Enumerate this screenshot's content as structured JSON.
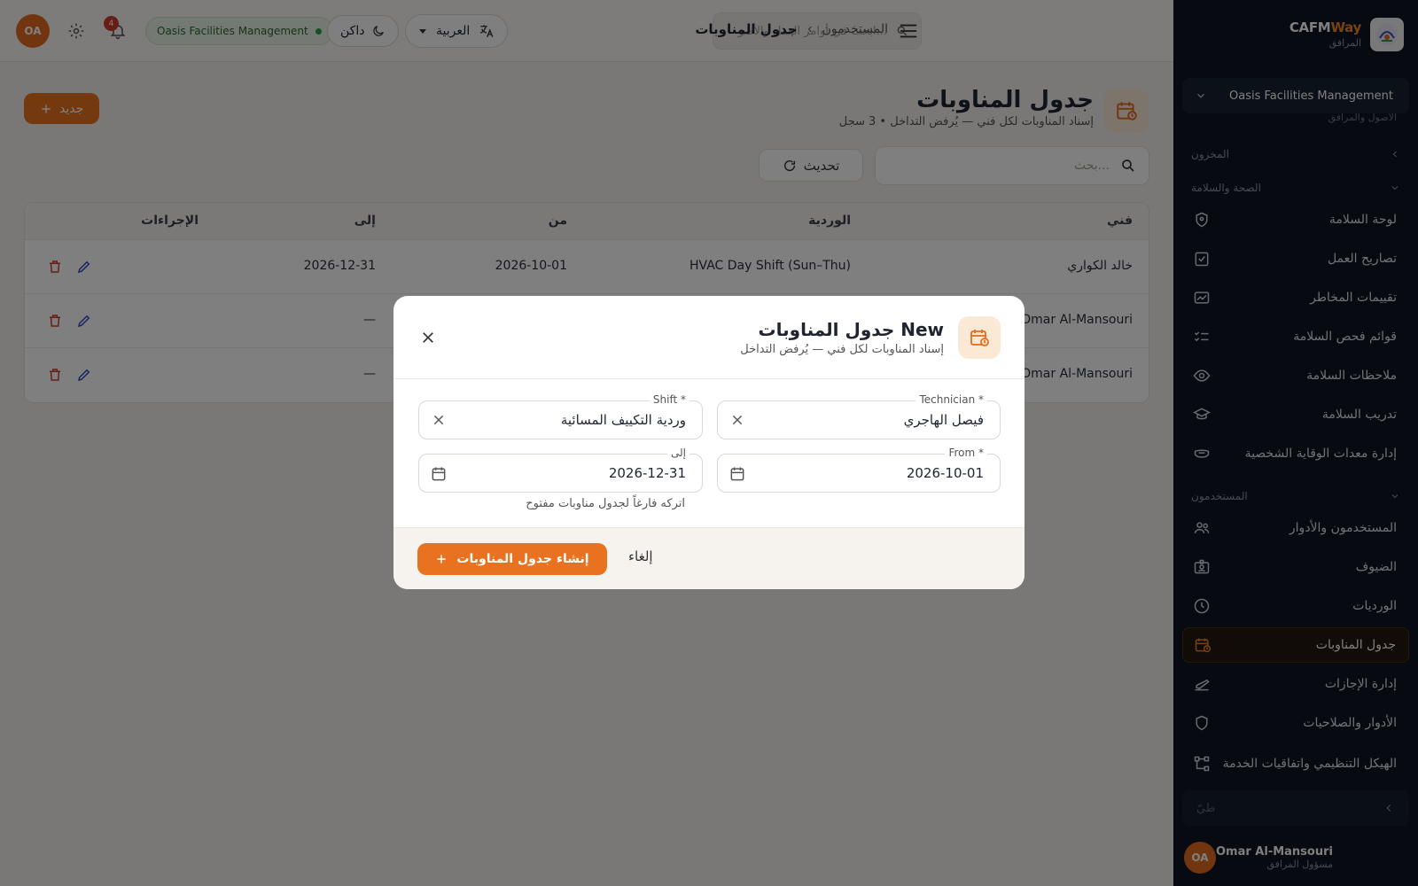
{
  "app": {
    "brand_primary": "CAFM",
    "brand_accent": "Way",
    "brand_sub": "المرافق"
  },
  "sidebar": {
    "org": "Oasis Facilities Management",
    "cut_section": "الأصول والمرافق",
    "sections": [
      {
        "label": "المخزون"
      },
      {
        "label": "الصحة والسلامة"
      },
      {
        "label": "المستخدمون"
      }
    ],
    "items": [
      {
        "label": "لوحة السلامة",
        "icon": "shield-icon"
      },
      {
        "label": "تصاريح العمل",
        "icon": "clipboard-check-icon"
      },
      {
        "label": "تقييمات المخاطر",
        "icon": "chart-icon"
      },
      {
        "label": "قوائم فحص السلامة",
        "icon": "checklist-icon"
      },
      {
        "label": "ملاحظات السلامة",
        "icon": "eye-icon"
      },
      {
        "label": "تدريب السلامة",
        "icon": "graduation-cap-icon"
      },
      {
        "label": "إدارة معدات الوقاية الشخصية",
        "icon": "mask-icon"
      },
      {
        "label": "المستخدمون والأدوار",
        "icon": "users-icon"
      },
      {
        "label": "الضيوف",
        "icon": "badge-icon"
      },
      {
        "label": "الورديات",
        "icon": "clock-icon"
      },
      {
        "label": "جدول المناوبات",
        "icon": "calendar-clock-icon",
        "active": true
      },
      {
        "label": "إدارة الإجازات",
        "icon": "plane-icon"
      },
      {
        "label": "الأدوار والصلاحيات",
        "icon": "shield-outline-icon"
      },
      {
        "label": "الهيكل التنظيمي واتفاقيات الخدمة",
        "icon": "org-chart-icon"
      }
    ],
    "collapse_label": "طيّ",
    "user": {
      "initials": "OA",
      "name": "Omar Al-Mansouri",
      "role": "مسؤول المرافق"
    }
  },
  "topbar": {
    "avatar_initials": "OA",
    "notification_count": "4",
    "org_badge": "Oasis Facilities Management",
    "theme_label": "داكن",
    "language_label": "العربية",
    "search_placeholder": "ابحث في أوامر العمل والأصو...",
    "breadcrumb_parent": "المستخدمون",
    "breadcrumb_current": "جدول المناوبات"
  },
  "page": {
    "title": "جدول المناوبات",
    "subtitle": "إسناد المناوبات لكل فني — يُرفض التداخل",
    "record_count": "3 سجل",
    "new_button": "جديد",
    "search_placeholder": "بحث...",
    "refresh_label": "تحديث"
  },
  "table": {
    "headers": {
      "technician": "فني",
      "shift": "الوردية",
      "from": "من",
      "to": "إلى",
      "actions": "الإجراءات"
    },
    "rows": [
      {
        "technician": "خالد الكواري",
        "shift": "HVAC Day Shift (Sun–Thu)",
        "from": "2026-10-01",
        "to": "2026-12-31"
      },
      {
        "technician": "Omar Al-Mansouri",
        "shift": "",
        "from": "",
        "to": "—"
      },
      {
        "technician": "Omar Al-Mansouri",
        "shift": "",
        "from": "",
        "to": "—"
      }
    ]
  },
  "modal": {
    "title": "New جدول المناوبات",
    "subtitle": "إسناد المناوبات لكل فني — يُرفض التداخل",
    "technician_label": "Technician *",
    "technician_value": "فيصل الهاجري",
    "shift_label": "Shift *",
    "shift_value": "وردية التكييف المسائية",
    "from_label": "From *",
    "from_value": "2026-10-01",
    "to_label": "إلى",
    "to_value": "2026-12-31",
    "to_helper": "اتركه فارغاً لجدول مناوبات مفتوح",
    "create_button": "إنشاء جدول المناوبات",
    "cancel_button": "إلغاء"
  },
  "colors": {
    "accent": "#e8721f",
    "sidebar_bg": "#0f1521",
    "danger": "#d23a2f",
    "edit": "#2f47c8",
    "status_ok": "#2e9c44"
  }
}
